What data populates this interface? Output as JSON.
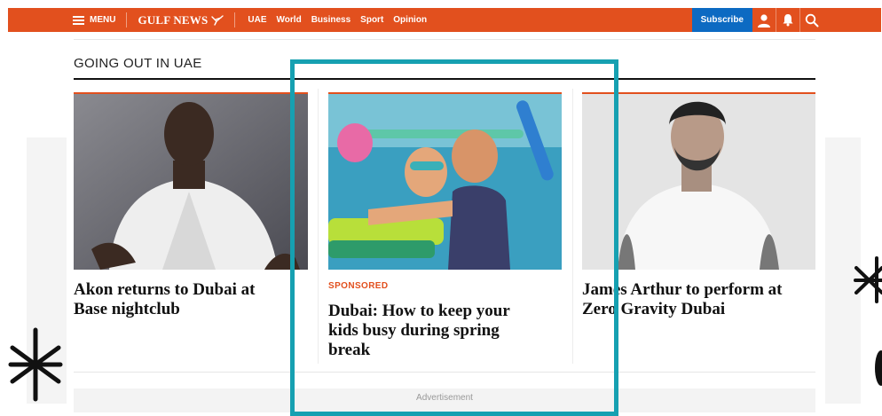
{
  "nav": {
    "menu_label": "MENU",
    "logo_text": "GULF NEWS",
    "links": [
      "UAE",
      "World",
      "Business",
      "Sport",
      "Opinion"
    ],
    "subscribe_label": "Subscribe"
  },
  "section": {
    "title": "GOING OUT IN UAE"
  },
  "cards": [
    {
      "title_line1": "Akon returns to Dubai at",
      "title_line2": "Base nightclub"
    },
    {
      "tag": "SPONSORED",
      "title_line1": "Dubai: How to keep your",
      "title_line2": "kids busy during spring",
      "title_line3": "break"
    },
    {
      "title_line1": "James Arthur to perform at",
      "title_line2": "Zero Gravity Dubai"
    }
  ],
  "ad": {
    "label": "Advertisement"
  },
  "colors": {
    "brand": "#e2501e",
    "subscribe": "#0c6ac2",
    "highlight": "#16a0b1"
  },
  "icons": [
    "menu-icon",
    "falcon-logo-icon",
    "user-icon",
    "bell-icon",
    "search-icon"
  ]
}
